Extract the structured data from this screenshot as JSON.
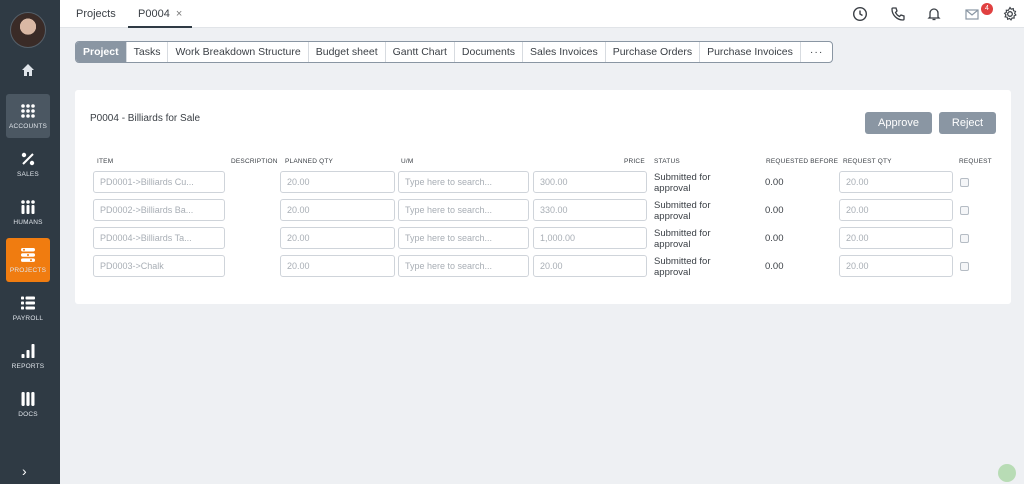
{
  "sidebar": {
    "items": [
      {
        "label": "ACCOUNTS"
      },
      {
        "label": "SALES"
      },
      {
        "label": "HUMANS"
      },
      {
        "label": "PROJECTS"
      },
      {
        "label": "PAYROLL"
      },
      {
        "label": "REPORTS"
      },
      {
        "label": "DOCS"
      }
    ],
    "expand": "›"
  },
  "topbar": {
    "tabs": [
      {
        "label": "Projects"
      },
      {
        "label": "P0004",
        "close": "×"
      }
    ],
    "notification_count": "4"
  },
  "subtabs": [
    "Project",
    "Tasks",
    "Work Breakdown Structure",
    "Budget sheet",
    "Gantt Chart",
    "Documents",
    "Sales Invoices",
    "Purchase Orders",
    "Purchase Invoices",
    "···"
  ],
  "panel": {
    "title": "P0004 - Billiards for Sale",
    "approve": "Approve",
    "reject": "Reject",
    "headers": {
      "item": "ITEM",
      "description": "DESCRIPTION",
      "planned_qty": "PLANNED QTY",
      "um": "U/M",
      "price": "PRICE",
      "status": "STATUS",
      "requested_before": "REQUESTED BEFORE",
      "request_qty": "REQUEST QTY",
      "request": "REQUEST"
    },
    "um_placeholder": "Type here to search...",
    "rows": [
      {
        "item": "PD0001->Billiards Cu...",
        "planned_qty": "20.00",
        "price": "300.00",
        "status": "Submitted for approval",
        "requested_before": "0.00",
        "request_qty": "20.00"
      },
      {
        "item": "PD0002->Billiards Ba...",
        "planned_qty": "20.00",
        "price": "330.00",
        "status": "Submitted for approval",
        "requested_before": "0.00",
        "request_qty": "20.00"
      },
      {
        "item": "PD0004->Billiards Ta...",
        "planned_qty": "20.00",
        "price": "1,000.00",
        "status": "Submitted for approval",
        "requested_before": "0.00",
        "request_qty": "20.00"
      },
      {
        "item": "PD0003->Chalk",
        "planned_qty": "20.00",
        "price": "20.00",
        "status": "Submitted for approval",
        "requested_before": "0.00",
        "request_qty": "20.00"
      }
    ]
  },
  "colors": {
    "sidebar_bg": "#2f3a44",
    "active_orange": "#f07c10",
    "button_gray": "#8a96a3"
  }
}
